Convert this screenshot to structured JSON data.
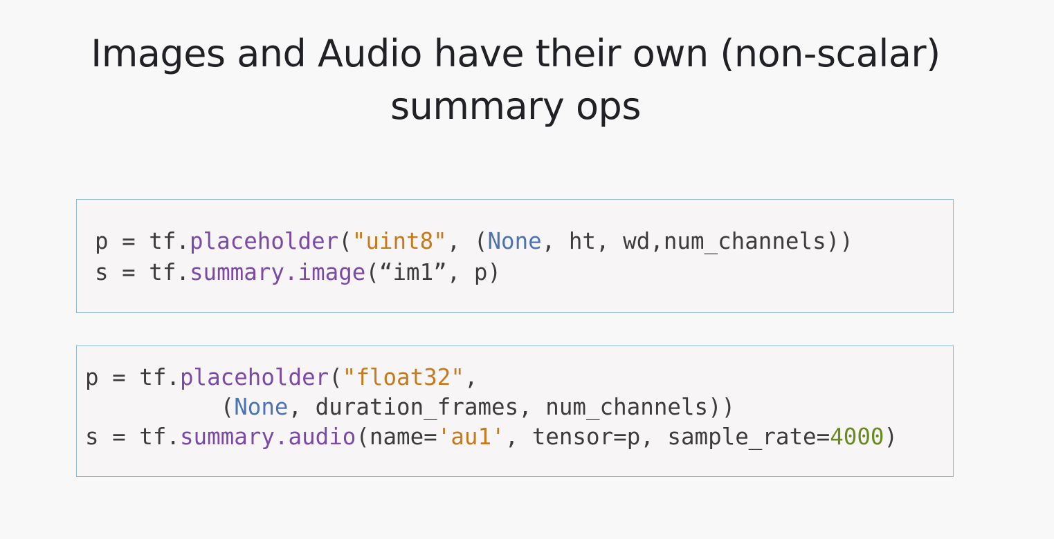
{
  "title": {
    "line1": "Images and Audio have their own (non-scalar)",
    "line2": "summary ops"
  },
  "code_block_1": {
    "line1": {
      "t1": "p = tf.",
      "fn": "placeholder",
      "t2": "(",
      "str": "\"uint8\"",
      "t3": ", (",
      "kw": "None",
      "t4": ", ht, wd,num_channels))"
    },
    "line2": {
      "t1": "s = tf.",
      "fn": "summary.image",
      "t2": "(“im1”, p)"
    }
  },
  "code_block_2": {
    "line1": {
      "t1": "p = tf.",
      "fn": "placeholder",
      "t2": "(",
      "str": "\"float32\"",
      "t3": ","
    },
    "line2": {
      "indent": "          (",
      "kw": "None",
      "t1": ", duration_frames, num_channels))"
    },
    "line3": {
      "t1": "s = tf.",
      "fn": "summary.audio",
      "t2": "(name=",
      "str": "'au1'",
      "t3": ", tensor=p, sample_rate=",
      "num": "4000",
      "t4": ")"
    }
  },
  "colors": {
    "background": "#f8f8f9",
    "title_text": "#202124",
    "code_border": "#8fb8d8",
    "code_bg": "#f7f5f6",
    "function": "#7b49a8",
    "string": "#c67a1c",
    "keyword": "#4b74b7",
    "number": "#6b8a1e"
  }
}
